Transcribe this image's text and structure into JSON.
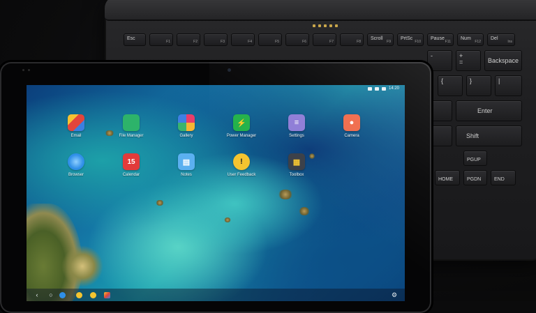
{
  "keyboard": {
    "row_fn": [
      "Esc",
      "F1",
      "F2",
      "F3",
      "F4",
      "F5",
      "F6",
      "F7",
      "F8",
      "Scroll",
      "PrtSc",
      "Pause",
      "Num",
      "Del"
    ],
    "row_fn_sub": [
      "",
      "",
      "",
      "",
      "",
      "",
      "",
      "",
      "",
      "F9",
      "F10",
      "F11",
      "F12",
      "Ins"
    ],
    "backspace": "Backspace",
    "enter": "Enter",
    "shift": "Shift",
    "pgup": "PGUP",
    "home": "HOME",
    "pgdn": "PGDN",
    "end": "END",
    "minus": "-",
    "plus": "+",
    "eq": "=",
    "lbrace": "{",
    "rbrace": "}",
    "pipe": "|",
    "colon": ":",
    "quote": "\""
  },
  "statusbar": {
    "time": "14:20"
  },
  "apps": [
    {
      "label": "Email",
      "color": "#e8eef2",
      "glyph": "◣"
    },
    {
      "label": "File Manager",
      "color": "#2db36a",
      "glyph": "▬"
    },
    {
      "label": "Gallery",
      "color": "#f2f2f2",
      "glyph": "◆"
    },
    {
      "label": "Power Manager",
      "color": "#23b24a",
      "glyph": "⚡"
    },
    {
      "label": "Settings",
      "color": "#8e7cd6",
      "glyph": "≡"
    },
    {
      "label": "Camera",
      "color": "#f06a4a",
      "glyph": "●"
    },
    {
      "label": "Browser",
      "color": "#2f8fe8",
      "glyph": "◐"
    },
    {
      "label": "Calendar",
      "color": "#e23b3b",
      "glyph": "15"
    },
    {
      "label": "Notes",
      "color": "#5bb0f0",
      "glyph": "▤"
    },
    {
      "label": "User Feedback",
      "color": "#f4c430",
      "glyph": "!"
    },
    {
      "label": "Toolbox",
      "color": "#3a3f48",
      "glyph": "▦"
    }
  ],
  "dock": {
    "back": "‹",
    "home": "○",
    "recent": "□"
  }
}
